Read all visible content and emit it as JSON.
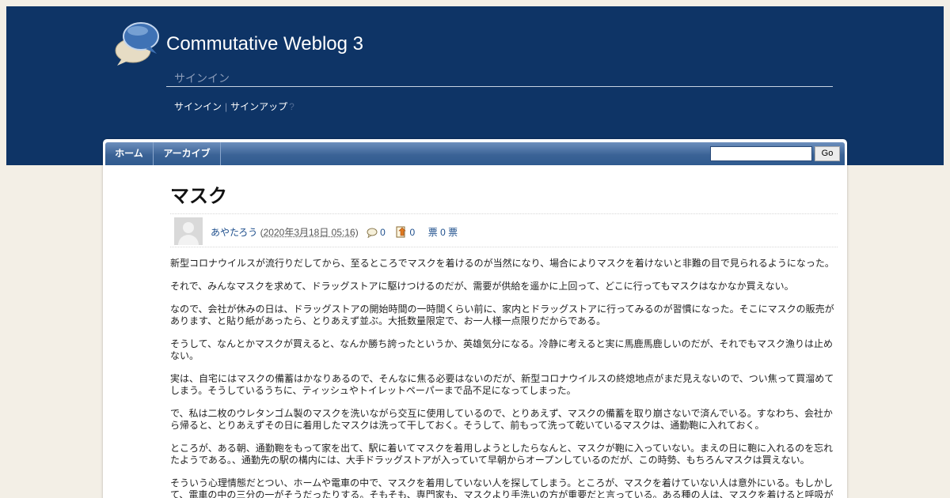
{
  "site": {
    "title": "Commutative Weblog 3",
    "signin_heading": "サインイン",
    "signin_link": "サインイン",
    "signup_link": "サインアップ",
    "separator": "|",
    "help_mark": "?"
  },
  "nav": {
    "home": "ホーム",
    "archive": "アーカイブ",
    "search_value": "",
    "go_label": "Go"
  },
  "post": {
    "title": "マスク",
    "author": "あやたろう",
    "date": "2020年3月18日 05:16",
    "comment_count": "0",
    "trackback_count": "0",
    "votes": "票 0 票",
    "paragraphs": [
      "新型コロナウイルスが流行りだしてから、至るところでマスクを着けるのが当然になり、場合によりマスクを着けないと非難の目で見られるようになった。",
      "それで、みんなマスクを求めて、ドラッグストアに駆けつけるのだが、需要が供給を遥かに上回って、どこに行ってもマスクはなかなか買えない。",
      "なので、会社が休みの日は、ドラッグストアの開始時間の一時間くらい前に、家内とドラッグストアに行ってみるのが習慣になった。そこにマスクの販売があります、と貼り紙があったら、とりあえず並ぶ。大抵数量限定で、お一人様一点限りだからである。",
      "そうして、なんとかマスクが買えると、なんか勝ち誇ったというか、英雄気分になる。冷静に考えると実に馬鹿馬鹿しいのだが、それでもマスク漁りは止めない。",
      "実は、自宅にはマスクの備蓄はかなりあるので、そんなに焦る必要はないのだが、新型コロナウイルスの終熄地点がまだ見えないので、つい焦って買溜めてしまう。そうしているうちに、ティッシュやトイレットペーパーまで品不足になってしまった。",
      "で、私は二枚のウレタンゴム製のマスクを洗いながら交互に使用しているので、とりあえず、マスクの備蓄を取り崩さないで済んでいる。すなわち、会社から帰ると、とりあえずその日に着用したマスクは洗って干しておく。そうして、前もって洗って乾いているマスクは、通勤鞄に入れておく。",
      "ところが、ある朝、通勤鞄をもって家を出て、駅に着いてマスクを着用しようとしたらなんと、マスクが鞄に入っていない。まえの日に鞄に入れるのを忘れたようである。、通勤先の駅の構内には、大手ドラッグストアが入っていて早朝からオープンしているのだが、この時勢、もちろんマスクは買えない。",
      "そういう心理情態だとつい、ホームや電車の中で、マスクを着用していない人を探してしまう。ところが、マスクを着けていない人は意外にいる。もしかして、電車の中の三分の一がそうだったりする。そもそも、専門家も、マスクより手洗いの方が重要だと言っている。ある種の人は、マスクを着けると呼吸が"
    ]
  }
}
